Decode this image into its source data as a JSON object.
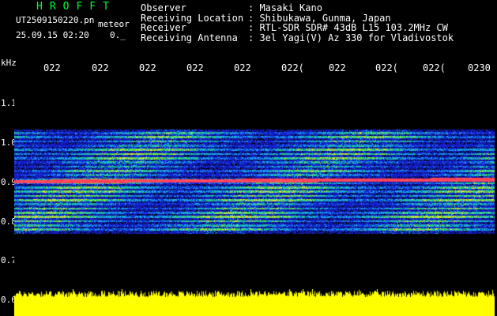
{
  "header": {
    "title": "HROFFT",
    "filename": "UT2509150220.pn",
    "mode": "meteor",
    "date_time": "25.09.15 02:20",
    "count": "0._"
  },
  "station": [
    {
      "key": "Observer",
      "value": ": Masaki Kano"
    },
    {
      "key": "Receiving Location",
      "value": ": Shibukawa, Gunma, Japan"
    },
    {
      "key": "Receiver",
      "value": ": RTL-SDR SDR# 43dB L15 103.2MHz CW"
    },
    {
      "key": "Receiving Antenna",
      "value": ": 3el Yagi(V) Az 330 for Vladivostok"
    }
  ],
  "axis": {
    "unit": "kHz",
    "y_labels": [
      "1.1",
      "1.0",
      "0.9",
      "0.8",
      "0.7",
      "0.6"
    ],
    "time_labels": [
      "022",
      "022",
      "022",
      "022",
      "022",
      "022(",
      "022",
      "022(",
      "022(",
      "0230"
    ]
  },
  "chart_data": {
    "type": "heatmap",
    "ylabel": "kHz",
    "ylim": [
      0.6,
      1.15
    ],
    "y_ticks": [
      1.1,
      1.0,
      0.9,
      0.8,
      0.7,
      0.6
    ],
    "x_ticks": [
      "022",
      "022",
      "022",
      "022",
      "022",
      "022(",
      "022",
      "022(",
      "022(",
      "0230"
    ],
    "signal_band_khz": [
      0.77,
      1.03
    ],
    "carrier_khz_start": 0.9,
    "carrier_khz_end": 0.905
  },
  "colors": {
    "title": "#00ff3c",
    "background": "#000000",
    "spectrum_base": "#1d1dc4",
    "carrier": "#ff3060",
    "level_bar": "#ffff00"
  }
}
